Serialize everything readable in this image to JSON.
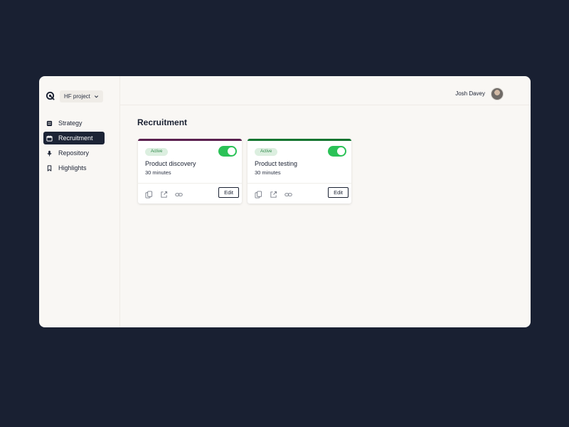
{
  "project": {
    "name": "HF project"
  },
  "nav": {
    "items": [
      {
        "label": "Strategy",
        "icon": "strategy-icon"
      },
      {
        "label": "Recruitment",
        "icon": "calendar-icon",
        "active": true
      },
      {
        "label": "Repository",
        "icon": "microphone-icon"
      },
      {
        "label": "Highlights",
        "icon": "bookmark-icon"
      }
    ]
  },
  "user": {
    "name": "Josh Davey"
  },
  "page": {
    "title": "Recruitment"
  },
  "cards": [
    {
      "status": "Active",
      "title": "Product discovery",
      "duration": "30 minutes",
      "enabled": true,
      "accent": "#5a1f4e",
      "edit_label": "Edit"
    },
    {
      "status": "Active",
      "title": "Product testing",
      "duration": "30 minutes",
      "enabled": true,
      "accent": "#13742f",
      "edit_label": "Edit"
    }
  ],
  "colors": {
    "background": "#192032",
    "panel": "#f9f7f4",
    "active_nav": "#1c2436",
    "toggle_on": "#2bc257"
  }
}
